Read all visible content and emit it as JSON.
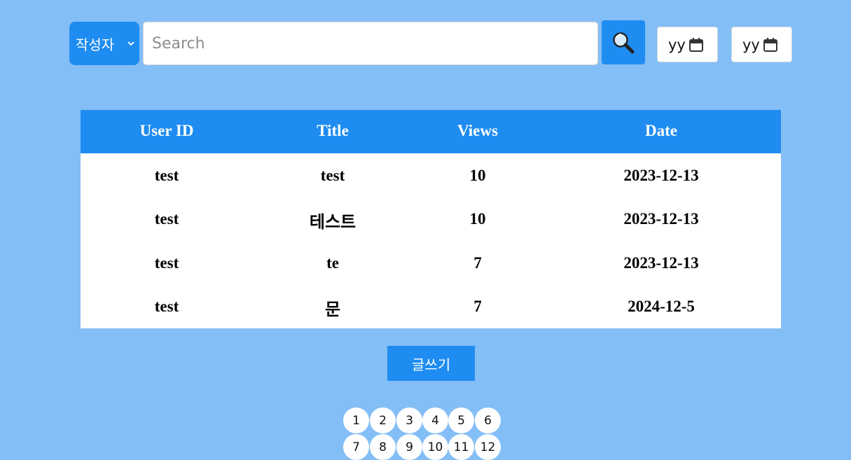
{
  "search": {
    "filter_label": "작성자",
    "placeholder": "Search",
    "value": "",
    "date_from": "yy",
    "date_to": "yy"
  },
  "table": {
    "headers": [
      "User ID",
      "Title",
      "Views",
      "Date"
    ],
    "rows": [
      [
        "test",
        "test",
        "10",
        "2023-12-13"
      ],
      [
        "test",
        "테스트",
        "10",
        "2023-12-13"
      ],
      [
        "test",
        "te",
        "7",
        "2023-12-13"
      ],
      [
        "test",
        "문",
        "7",
        "2024-12-5"
      ]
    ]
  },
  "write_button": "글쓰기",
  "pagination": {
    "pages": [
      "1",
      "2",
      "3",
      "4",
      "5",
      "6",
      "7",
      "8",
      "9",
      "10",
      "11",
      "12"
    ]
  },
  "colors": {
    "background": "#84bef6",
    "accent": "#1e8cf0"
  }
}
